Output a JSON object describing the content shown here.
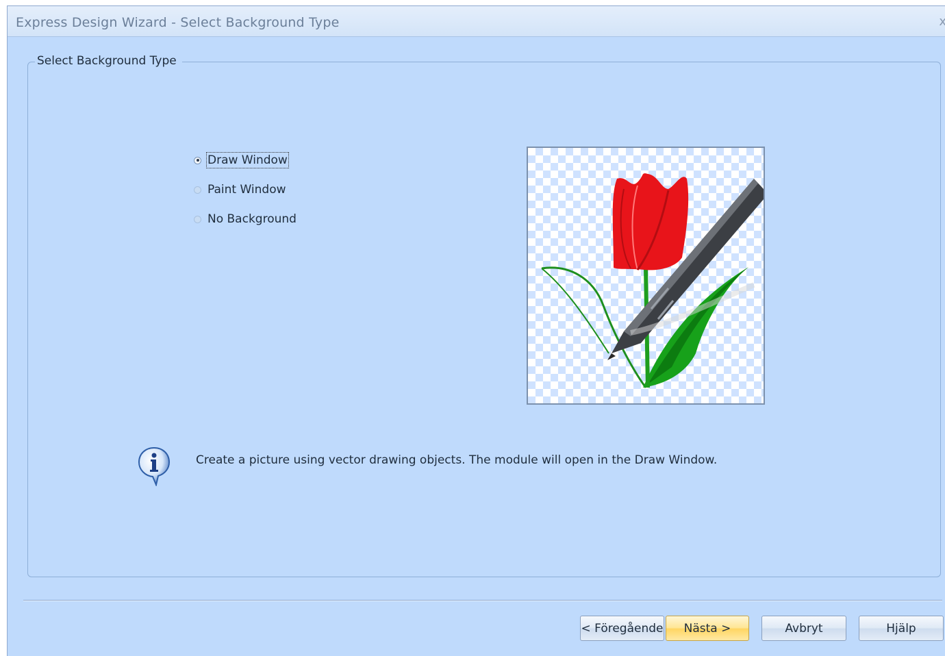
{
  "window": {
    "title": "Express Design Wizard - Select Background Type",
    "close_glyph": "x"
  },
  "group": {
    "legend": "Select Background Type"
  },
  "options": [
    {
      "label": "Draw Window",
      "selected": true
    },
    {
      "label": "Paint Window",
      "selected": false
    },
    {
      "label": "No Background",
      "selected": false
    }
  ],
  "info": {
    "icon": "info-icon",
    "text": "Create a picture using vector drawing objects. The module will open in the Draw Window."
  },
  "buttons": {
    "back": "< Föregående",
    "next": "Nästa >",
    "cancel": "Avbryt",
    "help": "Hjälp"
  },
  "colors": {
    "dialog_bg": "#bfdafc",
    "primary_button": "#ffd561",
    "tulip_red": "#e8141a",
    "leaf_green": "#17a11a"
  }
}
